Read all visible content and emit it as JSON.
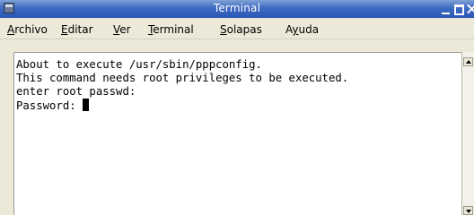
{
  "window": {
    "title": "Terminal",
    "icon": "terminal-app-icon",
    "controls": [
      "minimize-icon",
      "maximize-icon",
      "close-icon"
    ],
    "titlebar_color": "#2b58b4"
  },
  "menubar": {
    "items": [
      {
        "label": "Archivo",
        "mnemonic": "A"
      },
      {
        "label": "Editar",
        "mnemonic": "E"
      },
      {
        "label": "Ver",
        "mnemonic": "V"
      },
      {
        "label": "Terminal",
        "mnemonic": "T"
      },
      {
        "label": "Solapas",
        "mnemonic": "S"
      },
      {
        "label": "Ayuda",
        "mnemonic": "y"
      }
    ]
  },
  "terminal": {
    "lines": [
      "About to execute /usr/sbin/pppconfig.",
      "This command needs root privileges to be executed.",
      "enter root passwd:",
      "Password: "
    ],
    "cursor": "block"
  }
}
